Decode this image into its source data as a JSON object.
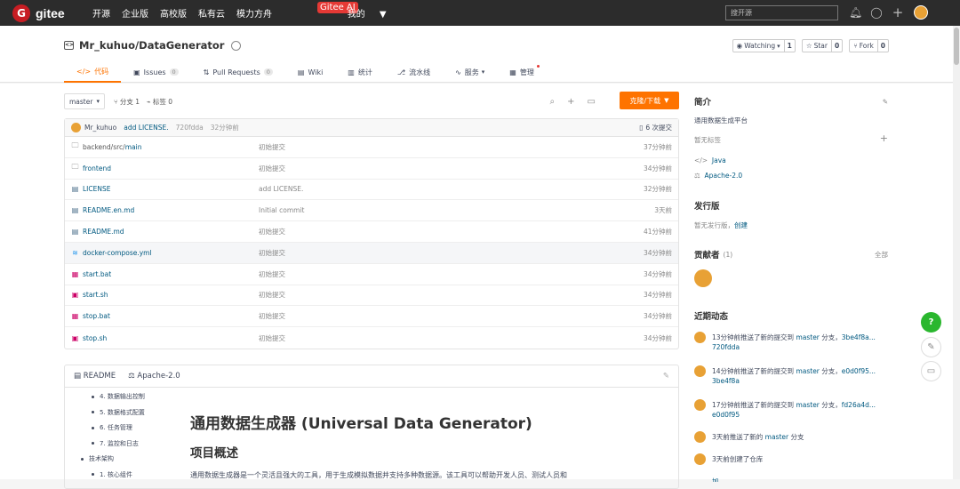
{
  "topbar": {
    "logo": "gitee",
    "nav": [
      "开源",
      "企业版",
      "高校版",
      "私有云",
      "模力方舟",
      "我的"
    ],
    "ai_badge": "Gitee AI",
    "search_placeholder": "搜开源"
  },
  "repo": {
    "title": "Mr_kuhuo/DataGenerator",
    "watching_label": "Watching",
    "watching_count": "1",
    "star_label": "Star",
    "star_count": "0",
    "fork_label": "Fork",
    "fork_count": "0"
  },
  "tabs": [
    {
      "label": "代码",
      "count": ""
    },
    {
      "label": "Issues",
      "count": "0"
    },
    {
      "label": "Pull Requests",
      "count": "0"
    },
    {
      "label": "Wiki",
      "count": ""
    },
    {
      "label": "统计",
      "count": ""
    },
    {
      "label": "流水线",
      "count": ""
    },
    {
      "label": "服务",
      "count": ""
    },
    {
      "label": "管理",
      "count": ""
    }
  ],
  "toolbar": {
    "branch": "master",
    "branches": "分支 1",
    "tags": "标签 0",
    "clone_label": "克隆/下载"
  },
  "commit": {
    "author": "Mr_kuhuo",
    "message": "add LICENSE.",
    "hash": "720fdda",
    "time": "32分钟前",
    "count": "6 次提交"
  },
  "files": [
    {
      "icon": "folder-icon",
      "name_dim": "backend/src/",
      "name": "main",
      "commit": "初始提交",
      "time": "37分钟前"
    },
    {
      "icon": "folder-icon",
      "name_dim": "",
      "name": "frontend",
      "commit": "初始提交",
      "time": "34分钟前"
    },
    {
      "icon": "file-text-icon",
      "name_dim": "",
      "name": "LICENSE",
      "commit": "add LICENSE.",
      "time": "32分钟前"
    },
    {
      "icon": "file-text-icon",
      "name_dim": "",
      "name": "README.en.md",
      "commit": "Initial commit",
      "time": "3天前"
    },
    {
      "icon": "file-text-icon",
      "name_dim": "",
      "name": "README.md",
      "commit": "初始提交",
      "time": "41分钟前"
    },
    {
      "icon": "docker-icon",
      "name_dim": "",
      "name": "docker-compose.yml",
      "commit": "初始提交",
      "time": "34分钟前"
    },
    {
      "icon": "windows-icon",
      "name_dim": "",
      "name": "start.bat",
      "commit": "初始提交",
      "time": "34分钟前"
    },
    {
      "icon": "terminal-icon",
      "name_dim": "",
      "name": "start.sh",
      "commit": "初始提交",
      "time": "34分钟前"
    },
    {
      "icon": "windows-icon",
      "name_dim": "",
      "name": "stop.bat",
      "commit": "初始提交",
      "time": "34分钟前"
    },
    {
      "icon": "terminal-icon",
      "name_dim": "",
      "name": "stop.sh",
      "commit": "初始提交",
      "time": "34分钟前"
    }
  ],
  "readme": {
    "tab_readme": "README",
    "tab_license": "Apache-2.0",
    "toc": [
      {
        "text": "4. 数据输出控制",
        "level": 2
      },
      {
        "text": "5. 数据格式配置",
        "level": 2
      },
      {
        "text": "6. 任务管理",
        "level": 2
      },
      {
        "text": "7. 监控和日志",
        "level": 2
      },
      {
        "text": "技术架构",
        "level": 1
      },
      {
        "text": "1. 核心组件",
        "level": 2
      }
    ],
    "h1": "通用数据生成器 (Universal Data Generator)",
    "h2": "项目概述",
    "p": "通用数据生成器是一个灵活且强大的工具，用于生成模拟数据并支持多种数据源。该工具可以帮助开发人员、测试人员和"
  },
  "sidebar": {
    "intro_title": "简介",
    "intro_text": "通用数据生成平台",
    "no_tags": "暂无标签",
    "language": "Java",
    "license": "Apache-2.0",
    "release_title": "发行版",
    "release_text": "暂无发行版，",
    "release_create": "创建",
    "contrib_title": "贡献者",
    "contrib_count": "(1)",
    "contrib_all": "全部",
    "activity_title": "近期动态",
    "activities": [
      {
        "pre": "13分钟前推送了新的提交到 ",
        "link": "master",
        "mid": " 分支，",
        "link2": "3be4f8a...",
        "line2": "720fdda"
      },
      {
        "pre": "14分钟前推送了新的提交到 ",
        "link": "master",
        "mid": " 分支，",
        "link2": "e0d0f95...",
        "line2": "3be4f8a"
      },
      {
        "pre": "17分钟前推送了新的提交到 ",
        "link": "master",
        "mid": " 分支，",
        "link2": "fd26a4d...",
        "line2": "e0d0f95"
      },
      {
        "pre": "3天前推送了新的 ",
        "link": "master",
        "mid": " 分支",
        "link2": "",
        "line2": ""
      },
      {
        "pre": "3天前创建了仓库",
        "link": "",
        "mid": "",
        "link2": "",
        "line2": ""
      }
    ],
    "more": "加载更多"
  },
  "colors": {
    "accent": "#fe7300",
    "brand": "#c71d23",
    "link": "#005980",
    "help": "#2ab72e"
  }
}
